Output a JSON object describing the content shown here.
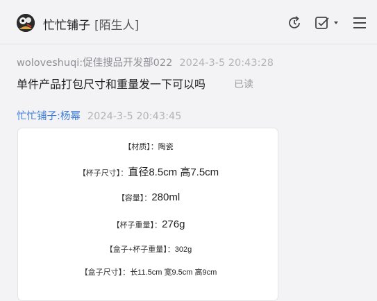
{
  "header": {
    "contact_name": "忙忙铺子",
    "contact_tag": "[陌生人]",
    "icons": [
      "refresh-icon",
      "task-check-icon",
      "dropdown-arrow-icon",
      "menu-icon"
    ]
  },
  "messages": [
    {
      "sender": "woloveshuqi:促佳搜品开发部022",
      "time": "2024-3-5 20:43:28",
      "text": "单件产品打包尺寸和重量发一下可以吗",
      "status": "已读"
    },
    {
      "sender": "忙忙铺子:杨幂",
      "time": "2024-3-5 20:43:45",
      "specs": [
        {
          "label": "【材质】：",
          "value": "陶瓷"
        },
        {
          "label": "【杯子尺寸】：",
          "value": "直径8.5cm 高7.5cm"
        },
        {
          "label": "【容量】：",
          "value": "280ml"
        },
        {
          "label": "【杯子重量】：",
          "value": "276g"
        },
        {
          "label": "【盒子+杯子重量】：",
          "value": "302g"
        },
        {
          "label": "【盒子尺寸】：",
          "value": "长11.5cm 宽9.5cm 高9cm"
        }
      ]
    }
  ],
  "colors": {
    "background": "#f3f3f5",
    "sender_link": "#3b7bd8",
    "card": "#ffffff"
  }
}
